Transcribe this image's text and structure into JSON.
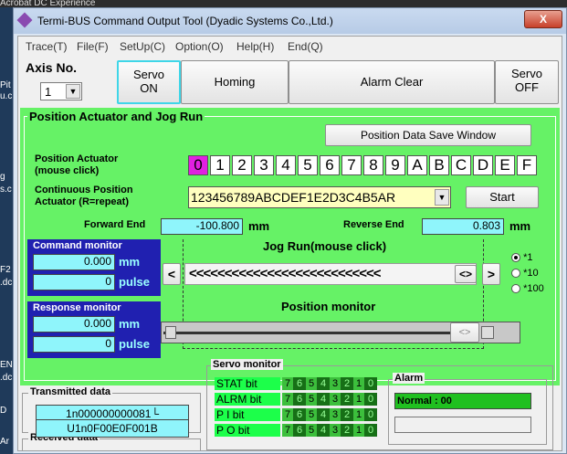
{
  "desktop": {
    "top_text": "Acrobat DC     Experience",
    "left_labels": [
      "Pit",
      "u.c",
      "g",
      "s.c",
      "F2",
      ".dc",
      "EN",
      ".dc",
      "D",
      "Ar"
    ]
  },
  "window": {
    "title": "Termi-BUS Command Output Tool (Dyadic Systems Co.,Ltd.)",
    "close": "X"
  },
  "menu": [
    "Trace(T)",
    "File(F)",
    "SetUp(C)",
    "Option(O)",
    "Help(H)",
    "End(Q)"
  ],
  "axis": {
    "label": "Axis No.",
    "value": "1"
  },
  "toolbar": {
    "servo_on": [
      "Servo",
      "ON"
    ],
    "homing": "Homing",
    "alarm_clear": "Alarm Clear",
    "servo_off": [
      "Servo",
      "OFF"
    ]
  },
  "position_panel": {
    "title": "Position Actuator and Jog Run",
    "save_window": "Position Data Save Window",
    "pa_label": [
      "Position Actuator",
      "(mouse click)"
    ],
    "positions": [
      "0",
      "1",
      "2",
      "3",
      "4",
      "5",
      "6",
      "7",
      "8",
      "9",
      "A",
      "B",
      "C",
      "D",
      "E",
      "F"
    ],
    "selected_position": "0",
    "cont_label": [
      "Continuous Position",
      "Actuator  (R=repeat)"
    ],
    "cont_value": "123456789ABCDEF1E2D3C4B5AR",
    "start": "Start",
    "forward_end_label": "Forward End",
    "forward_end": "-100.800",
    "forward_unit": "mm",
    "reverse_end_label": "Reverse End",
    "reverse_end": "0.803",
    "reverse_unit": "mm",
    "jog_label": "Jog Run(mouse click)",
    "jog_left": "<",
    "jog_arrows": "<<<<<<<<<<<<<<<<<<<<<<<<<<<",
    "jog_center": "<>",
    "jog_right": ">",
    "speed_options": [
      "*1",
      "*10",
      "*100"
    ],
    "speed_selected": "*1",
    "position_monitor_label": "Position monitor",
    "position_monitor_thumb": "<>"
  },
  "command_monitor": {
    "title": "Command monitor",
    "mm": "0.000",
    "mm_unit": "mm",
    "pulse": "0",
    "pulse_unit": "pulse"
  },
  "response_monitor": {
    "title": "Response monitor",
    "mm": "0.000",
    "mm_unit": "mm",
    "pulse": "0",
    "pulse_unit": "pulse"
  },
  "transmitted": {
    "title": "Transmitted data",
    "value": "1n000000000081└"
  },
  "received": {
    "title": "Received data",
    "value": "U1n0F00E0F001B"
  },
  "servo_monitor": {
    "title": "Servo monitor",
    "rows": [
      {
        "label": "STAT  bit"
      },
      {
        "label": "ALRM  bit"
      },
      {
        "label": "P I    bit"
      },
      {
        "label": "P O   bit"
      }
    ],
    "bits": [
      "7",
      "6",
      "5",
      "4",
      "3",
      "2",
      "1",
      "0"
    ]
  },
  "alarm": {
    "title": "Alarm",
    "status": "Normal : 00"
  },
  "colors": {
    "panel_green": "#66f266",
    "cyan": "#8ff5fb",
    "monitor_blue": "#2020b0",
    "selected_magenta": "#e020e0"
  }
}
